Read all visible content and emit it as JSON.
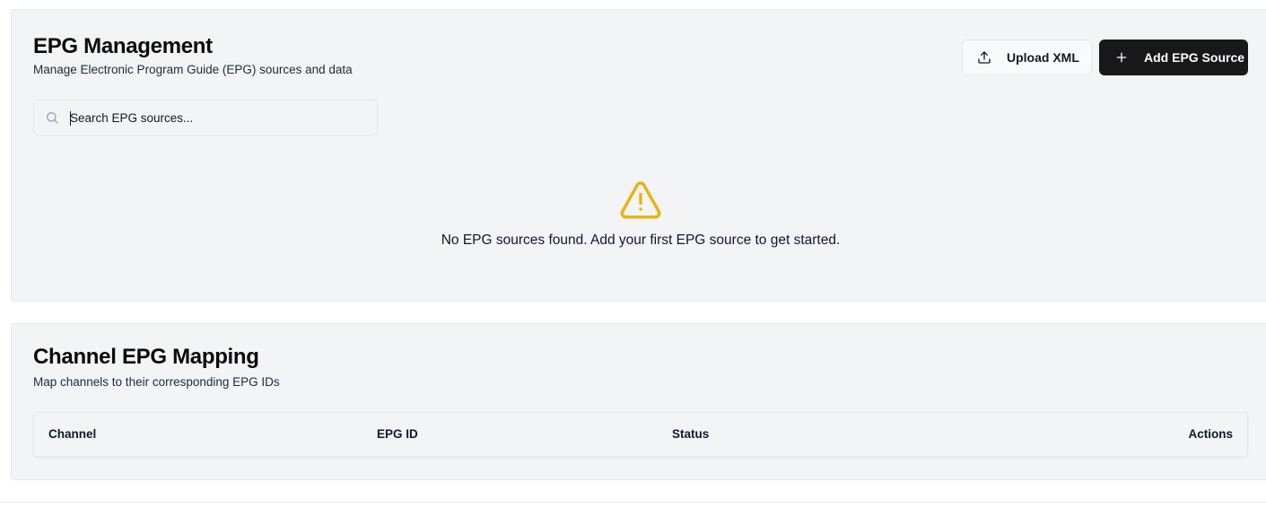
{
  "epg_management": {
    "title": "EPG Management",
    "subtitle": "Manage Electronic Program Guide (EPG) sources and data",
    "upload_button": {
      "label": "Upload XML",
      "icon": "upload-icon"
    },
    "add_button": {
      "label": "Add EPG Source",
      "icon": "plus-icon"
    },
    "search": {
      "placeholder": "Search EPG sources...",
      "value": "",
      "icon": "search-icon"
    },
    "empty_state": {
      "icon": "warning-icon",
      "icon_color": "#eab308",
      "message": "No EPG sources found. Add your first EPG source to get started."
    }
  },
  "channel_mapping": {
    "title": "Channel EPG Mapping",
    "subtitle": "Map channels to their corresponding EPG IDs",
    "table": {
      "columns": [
        "Channel",
        "EPG ID",
        "Status",
        "Actions"
      ],
      "rows": []
    }
  },
  "colors": {
    "primary_button": "#18181b",
    "card_background": "#f3f4f6",
    "border": "#e5e7eb",
    "warning": "#eab308"
  }
}
